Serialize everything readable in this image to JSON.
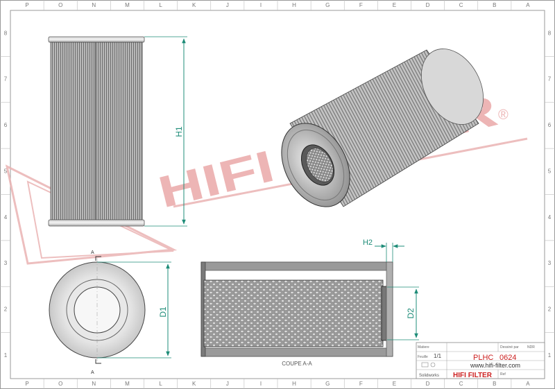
{
  "border": {
    "columns": [
      "P",
      "O",
      "N",
      "M",
      "L",
      "K",
      "J",
      "I",
      "H",
      "G",
      "F",
      "E",
      "D",
      "C",
      "B",
      "A"
    ],
    "rows": [
      "8",
      "7",
      "6",
      "5",
      "4",
      "3",
      "2",
      "1"
    ]
  },
  "watermark": {
    "text": "HIFI FILTER",
    "registered_mark": "®",
    "color": "#e8a0a0"
  },
  "dimensions": {
    "h1": "H1",
    "h2": "H2",
    "d1": "D1",
    "d2": "D2",
    "color": "#1e8c78"
  },
  "section_marks": {
    "top": "A",
    "bottom": "A"
  },
  "section_caption": "COUPE A-A",
  "title_block": {
    "matiere_label": "Matiere",
    "matiere_value": "",
    "dessine_label": "Dessiné par",
    "dessine_value": "NDR",
    "feuille_label": "Feuille",
    "feuille_value": "1/1",
    "part_prefix": "PLHC",
    "part_number": "0624",
    "website": "www.hifi-filter.com",
    "software": "Solidworks",
    "brand": "HIFI FILTER",
    "ref_label": "Ref",
    "brand_color": "#cc1f1f"
  }
}
